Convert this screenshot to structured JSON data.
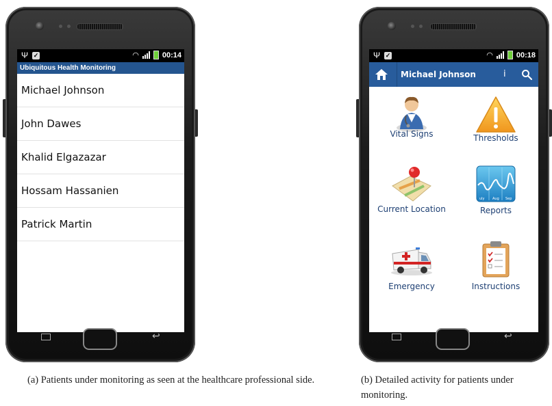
{
  "phone_a": {
    "status": {
      "time": "00:14"
    },
    "app_title": "Ubiquitous Health Monitoring",
    "patients": [
      "Michael Johnson",
      "John Dawes",
      "Khalid Elgazazar",
      "Hossam Hassanien",
      "Patrick Martin"
    ]
  },
  "phone_b": {
    "status": {
      "time": "00:18"
    },
    "action_bar": {
      "title": "Michael Johnson",
      "info_glyph": "i"
    },
    "tiles": [
      {
        "label": "Vital Signs",
        "icon": "doctor-icon"
      },
      {
        "label": "Thresholds",
        "icon": "warning-icon"
      },
      {
        "label": "Current Location",
        "icon": "map-pin-icon"
      },
      {
        "label": "Reports",
        "icon": "chart-report-icon"
      },
      {
        "label": "Emergency",
        "icon": "ambulance-icon"
      },
      {
        "label": "Instructions",
        "icon": "clipboard-icon"
      }
    ],
    "report_axis_labels": [
      "uly",
      "Aug",
      "Sep"
    ]
  },
  "captions": {
    "a": "(a) Patients under monitoring as seen at the healthcare professional side.",
    "b": "(b) Detailed activity for patients under monitoring."
  },
  "colors": {
    "title_bar": "#24558f",
    "action_bar": "#285c9c",
    "label_text": "#1d3f73"
  }
}
